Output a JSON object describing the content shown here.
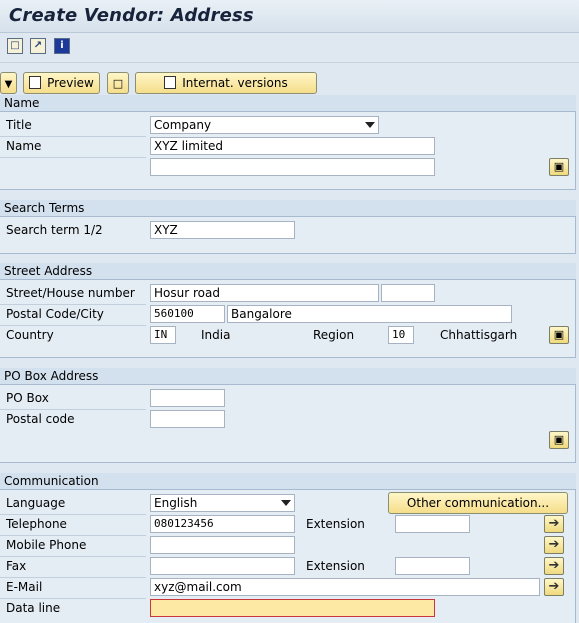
{
  "window": {
    "title": "Create Vendor: Address"
  },
  "toolbar": {
    "icons": [
      "copy-doc-icon",
      "paste-doc-icon",
      "info-icon"
    ],
    "preview_label": "Preview",
    "internat_label": "Internat. versions",
    "expand_icon": "expand-icon"
  },
  "name_group": {
    "header": "Name",
    "title_label": "Title",
    "title_value": "Company",
    "name_label": "Name",
    "name_value": "XYZ limited",
    "name2_value": ""
  },
  "search_group": {
    "header": "Search Terms",
    "term_label": "Search term 1/2",
    "term_value": "XYZ"
  },
  "street_group": {
    "header": "Street Address",
    "street_label": "Street/House number",
    "street_value": "Hosur road",
    "house_value": "",
    "postal_label": "Postal Code/City",
    "postal_value": "560100",
    "city_value": "Bangalore",
    "country_label": "Country",
    "country_code": "IN",
    "country_name": "India",
    "region_label": "Region",
    "region_code": "10",
    "region_name": "Chhattisgarh"
  },
  "pobox_group": {
    "header": "PO Box Address",
    "pobox_label": "PO Box",
    "pobox_value": "",
    "postal_label": "Postal code",
    "postal_value": ""
  },
  "comm_group": {
    "header": "Communication",
    "language_label": "Language",
    "language_value": "English",
    "other_comm_label": "Other communication...",
    "telephone_label": "Telephone",
    "telephone_value": "080123456",
    "extension_label": "Extension",
    "telephone_ext": "",
    "mobile_label": "Mobile Phone",
    "mobile_value": "",
    "fax_label": "Fax",
    "fax_value": "",
    "fax_extension_label": "Extension",
    "fax_ext": "",
    "email_label": "E-Mail",
    "email_value": "xyz@mail.com",
    "dataline_label": "Data line",
    "dataline_value": ""
  },
  "colors": {
    "button_gradient_top": "#fff7c8",
    "button_gradient_bottom": "#f5dd8a",
    "group_header": "#d3e0ee",
    "background": "#dfe8f1",
    "focus_border": "#c9363c"
  }
}
